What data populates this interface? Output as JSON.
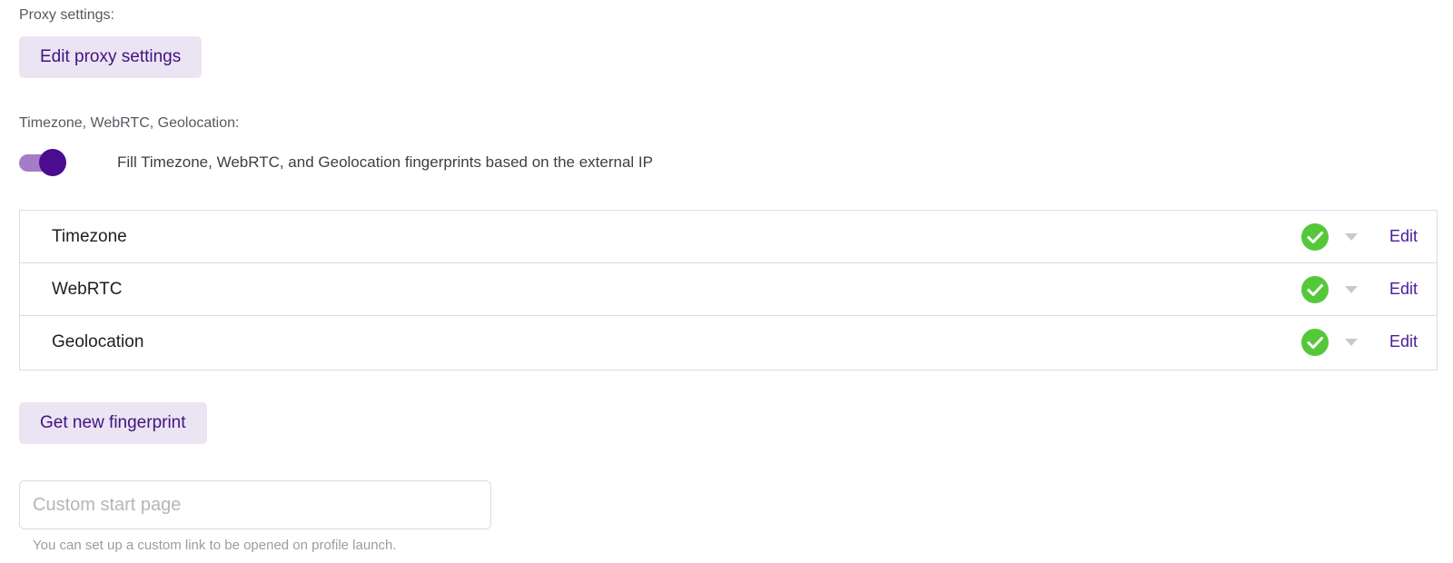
{
  "proxy": {
    "label": "Proxy settings:",
    "edit_button": "Edit proxy settings"
  },
  "geo": {
    "label": "Timezone, WebRTC, Geolocation:",
    "toggle_text": "Fill Timezone, WebRTC, and Geolocation fingerprints based on the external IP",
    "toggle_on": true
  },
  "fingerprints": {
    "rows": [
      {
        "name": "Timezone",
        "status": "check-icon",
        "edit": "Edit"
      },
      {
        "name": "WebRTC",
        "status": "check-icon",
        "edit": "Edit"
      },
      {
        "name": "Geolocation",
        "status": "check-icon",
        "edit": "Edit"
      }
    ]
  },
  "new_fingerprint_button": "Get new fingerprint",
  "start_page": {
    "value": "",
    "placeholder": "Custom start page",
    "hint": "You can set up a custom link to be opened on profile launch."
  },
  "colors": {
    "accent": "#4a0d8f",
    "button_bg": "#ebe4f2",
    "success": "#55c83a"
  }
}
